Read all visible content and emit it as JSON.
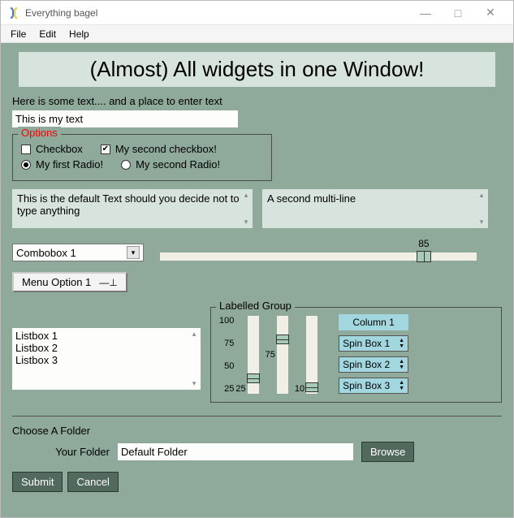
{
  "window": {
    "title": "Everything bagel"
  },
  "menus": {
    "file": "File",
    "edit": "Edit",
    "help": "Help"
  },
  "header": "(Almost) All widgets in one Window!",
  "intro_text": "Here is some text....  and a place to enter text",
  "text_input_value": "This is my text",
  "options": {
    "legend": "Options",
    "checkbox1": "Checkbox",
    "checkbox2": "My second checkbox!",
    "radio1": "My first Radio!",
    "radio2": "My second Radio!",
    "checkbox1_checked": false,
    "checkbox2_checked": true,
    "radio_selected": 1
  },
  "multiline": {
    "left": "This is the default Text should you decide not to type anything",
    "right": "A second multi-line"
  },
  "combo": {
    "selected": "Combobox 1"
  },
  "hslider": {
    "value": 85
  },
  "option_menu": {
    "label": "Menu Option 1"
  },
  "listbox": {
    "items": [
      "Listbox 1",
      "Listbox 2",
      "Listbox 3"
    ]
  },
  "labelled_group": {
    "legend": "Labelled Group",
    "slider_ticks": [
      "100",
      "75",
      "50",
      "25"
    ],
    "slider1": {
      "value": 25
    },
    "slider2": {
      "value": 75
    },
    "slider3": {
      "value": 10
    },
    "column_header": "Column 1",
    "spins": [
      "Spin Box 1",
      "Spin Box 2",
      "Spin Box 3"
    ]
  },
  "folder": {
    "section_label": "Choose A Folder",
    "field_label": "Your Folder",
    "value": "Default Folder",
    "browse": "Browse"
  },
  "buttons": {
    "submit": "Submit",
    "cancel": "Cancel"
  }
}
